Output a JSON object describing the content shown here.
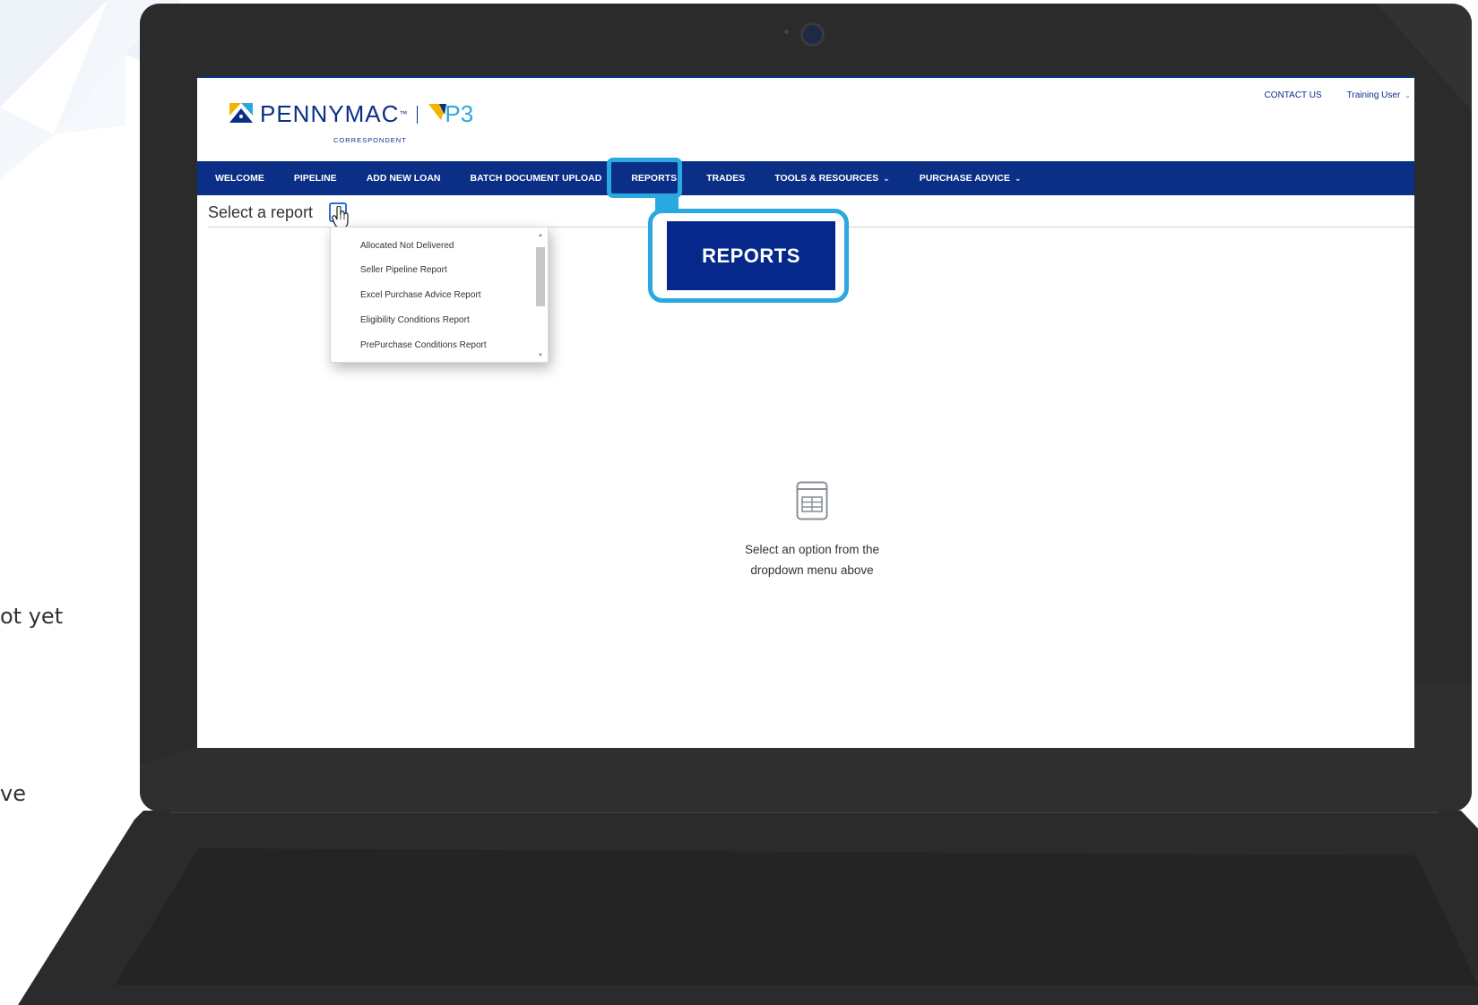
{
  "side_texts": [
    "ot yet",
    "ve"
  ],
  "header": {
    "brand": "PENNYMAC",
    "brand_sub": "CORRESPONDENT",
    "product": "P3",
    "contact_us": "CONTACT US",
    "user_menu": "Training User"
  },
  "nav": {
    "items": [
      {
        "label": "WELCOME",
        "has_menu": false
      },
      {
        "label": "PIPELINE",
        "has_menu": false
      },
      {
        "label": "ADD NEW LOAN",
        "has_menu": false
      },
      {
        "label": "BATCH DOCUMENT UPLOAD",
        "has_menu": false
      },
      {
        "label": "REPORTS",
        "has_menu": false
      },
      {
        "label": "TRADES",
        "has_menu": false
      },
      {
        "label": "TOOLS & RESOURCES",
        "has_menu": true
      },
      {
        "label": "PURCHASE ADVICE",
        "has_menu": true
      }
    ]
  },
  "report_select": {
    "label": "Select a report",
    "options": [
      "Allocated Not Delivered",
      "Seller Pipeline Report",
      "Excel Purchase Advice Report",
      "Eligibility Conditions Report",
      "PrePurchase Conditions Report"
    ]
  },
  "empty_state": {
    "line1": "Select an option from the",
    "line2": "dropdown menu above"
  },
  "callout": {
    "label": "REPORTS"
  },
  "colors": {
    "navy": "#0b2f86",
    "callout_blue": "#29a9e0",
    "laptop": "#2b2b2b"
  }
}
